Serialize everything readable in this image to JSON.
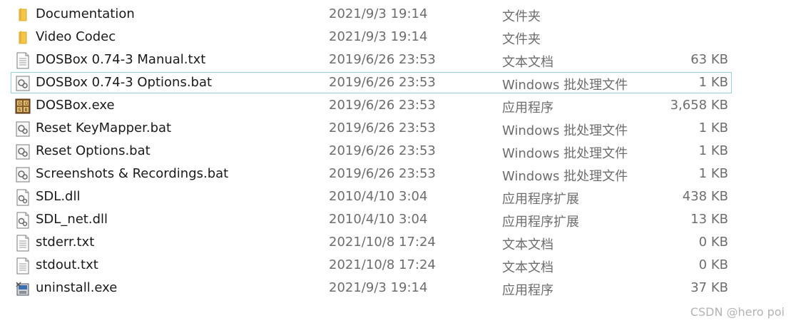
{
  "files": [
    {
      "icon": "folder-icon",
      "name": "Documentation",
      "date": "2021/9/3 19:14",
      "type": "文件夹",
      "size": ""
    },
    {
      "icon": "folder-icon",
      "name": "Video Codec",
      "date": "2021/9/3 19:14",
      "type": "文件夹",
      "size": ""
    },
    {
      "icon": "text-file-icon",
      "name": "DOSBox 0.74-3 Manual.txt",
      "date": "2019/6/26 23:53",
      "type": "文本文档",
      "size": "63 KB"
    },
    {
      "icon": "batch-file-icon",
      "name": "DOSBox 0.74-3 Options.bat",
      "date": "2019/6/26 23:53",
      "type": "Windows 批处理文件",
      "size": "1 KB",
      "selected": true
    },
    {
      "icon": "dosbox-app-icon",
      "name": "DOSBox.exe",
      "date": "2019/6/26 23:53",
      "type": "应用程序",
      "size": "3,658 KB"
    },
    {
      "icon": "batch-file-icon",
      "name": "Reset KeyMapper.bat",
      "date": "2019/6/26 23:53",
      "type": "Windows 批处理文件",
      "size": "1 KB"
    },
    {
      "icon": "batch-file-icon",
      "name": "Reset Options.bat",
      "date": "2019/6/26 23:53",
      "type": "Windows 批处理文件",
      "size": "1 KB"
    },
    {
      "icon": "batch-file-icon",
      "name": "Screenshots & Recordings.bat",
      "date": "2019/6/26 23:53",
      "type": "Windows 批处理文件",
      "size": "1 KB"
    },
    {
      "icon": "dll-file-icon",
      "name": "SDL.dll",
      "date": "2010/4/10 3:04",
      "type": "应用程序扩展",
      "size": "438 KB"
    },
    {
      "icon": "dll-file-icon",
      "name": "SDL_net.dll",
      "date": "2010/4/10 3:04",
      "type": "应用程序扩展",
      "size": "13 KB"
    },
    {
      "icon": "text-file-icon",
      "name": "stderr.txt",
      "date": "2021/10/8 17:24",
      "type": "文本文档",
      "size": "0 KB"
    },
    {
      "icon": "text-file-icon",
      "name": "stdout.txt",
      "date": "2021/10/8 17:24",
      "type": "文本文档",
      "size": "0 KB"
    },
    {
      "icon": "uninstaller-icon",
      "name": "uninstall.exe",
      "date": "2021/9/3 19:14",
      "type": "应用程序",
      "size": "37 KB"
    }
  ],
  "watermark": "CSDN @hero poi",
  "colors": {
    "selection_border": "#99d1db",
    "folder": "#f4c64a",
    "secondary_text": "#6d6d6d"
  }
}
